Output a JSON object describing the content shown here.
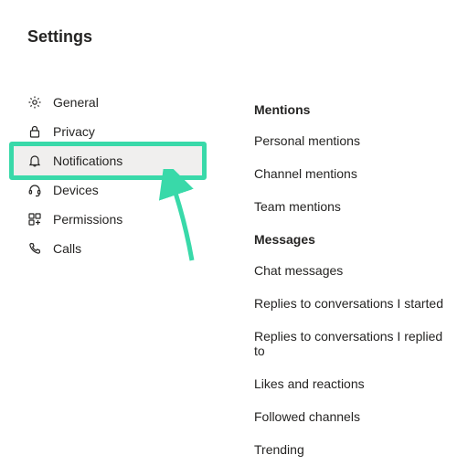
{
  "title": "Settings",
  "sidebar": {
    "items": [
      {
        "label": "General"
      },
      {
        "label": "Privacy"
      },
      {
        "label": "Notifications"
      },
      {
        "label": "Devices"
      },
      {
        "label": "Permissions"
      },
      {
        "label": "Calls"
      }
    ]
  },
  "content": {
    "sections": [
      {
        "header": "Mentions",
        "rows": [
          "Personal mentions",
          "Channel mentions",
          "Team mentions"
        ]
      },
      {
        "header": "Messages",
        "rows": [
          "Chat messages",
          "Replies to conversations I started",
          "Replies to conversations I replied to",
          "Likes and reactions",
          "Followed channels",
          "Trending"
        ]
      }
    ]
  }
}
